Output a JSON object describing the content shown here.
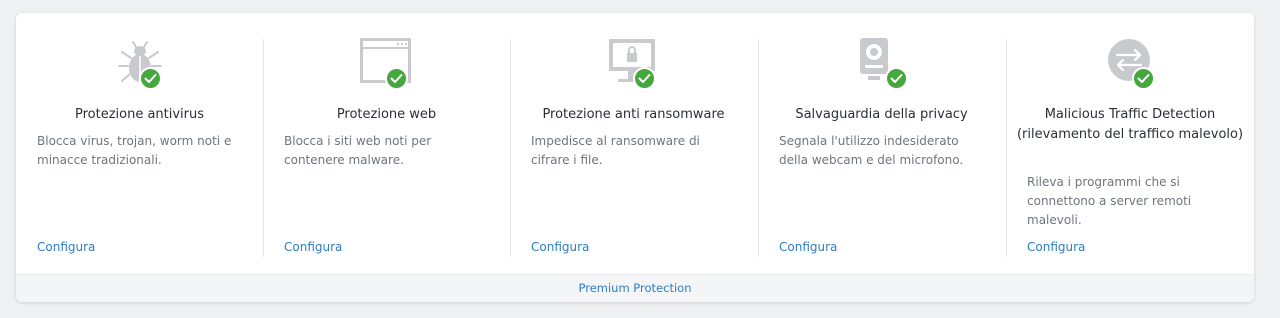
{
  "features": [
    {
      "icon": "bug-icon",
      "title": "Protezione antivirus",
      "description": "Blocca virus, trojan, worm noti e minacce tradizionali.",
      "link": "Configura",
      "status": "enabled"
    },
    {
      "icon": "browser-window-icon",
      "title": "Protezione web",
      "description": "Blocca i siti web noti per contenere malware.",
      "link": "Configura",
      "status": "enabled"
    },
    {
      "icon": "locked-monitor-icon",
      "title": "Protezione anti ransomware",
      "description": "Impedisce al ransomware di cifrare i file.",
      "link": "Configura",
      "status": "enabled"
    },
    {
      "icon": "webcam-icon",
      "title": "Salvaguardia della privacy",
      "description": "Segnala l'utilizzo indesiderato della webcam e del microfono.",
      "link": "Configura",
      "status": "enabled"
    },
    {
      "icon": "traffic-arrows-icon",
      "title": "Malicious Traffic Detection (rilevamento del traffico malevolo)",
      "description": "Rileva i programmi che si connettono a server remoti malevoli.",
      "link": "Configura",
      "status": "enabled"
    }
  ],
  "footer": {
    "label": "Premium Protection"
  },
  "colors": {
    "check": "#46a73e",
    "link": "#2f7dc4",
    "icon_gray": "#c8cacd"
  }
}
